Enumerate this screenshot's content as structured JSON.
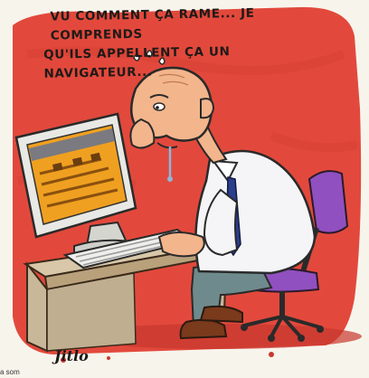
{
  "caption": {
    "line1": "VU COMMENT ÇA RAME... JE COMPRENDS",
    "line2": "QU'ILS APPELLENT ÇA UN NAVIGATEUR..."
  },
  "signature": "Jitlo",
  "bottom_text": "a som",
  "colors": {
    "background": "#e2493c",
    "paper": "#f7f4ec",
    "desk": "#c9b79a",
    "monitor": "#e8e8e4",
    "screen": "#f0a020",
    "shirt": "#f5f5f7",
    "tie": "#2b3e8c",
    "skin": "#f3b58c",
    "chair": "#9050c0",
    "trousers": "#6f8a8c",
    "shoe": "#7a3a1c"
  },
  "icons": [
    "sweat-drops",
    "drool-drip"
  ]
}
